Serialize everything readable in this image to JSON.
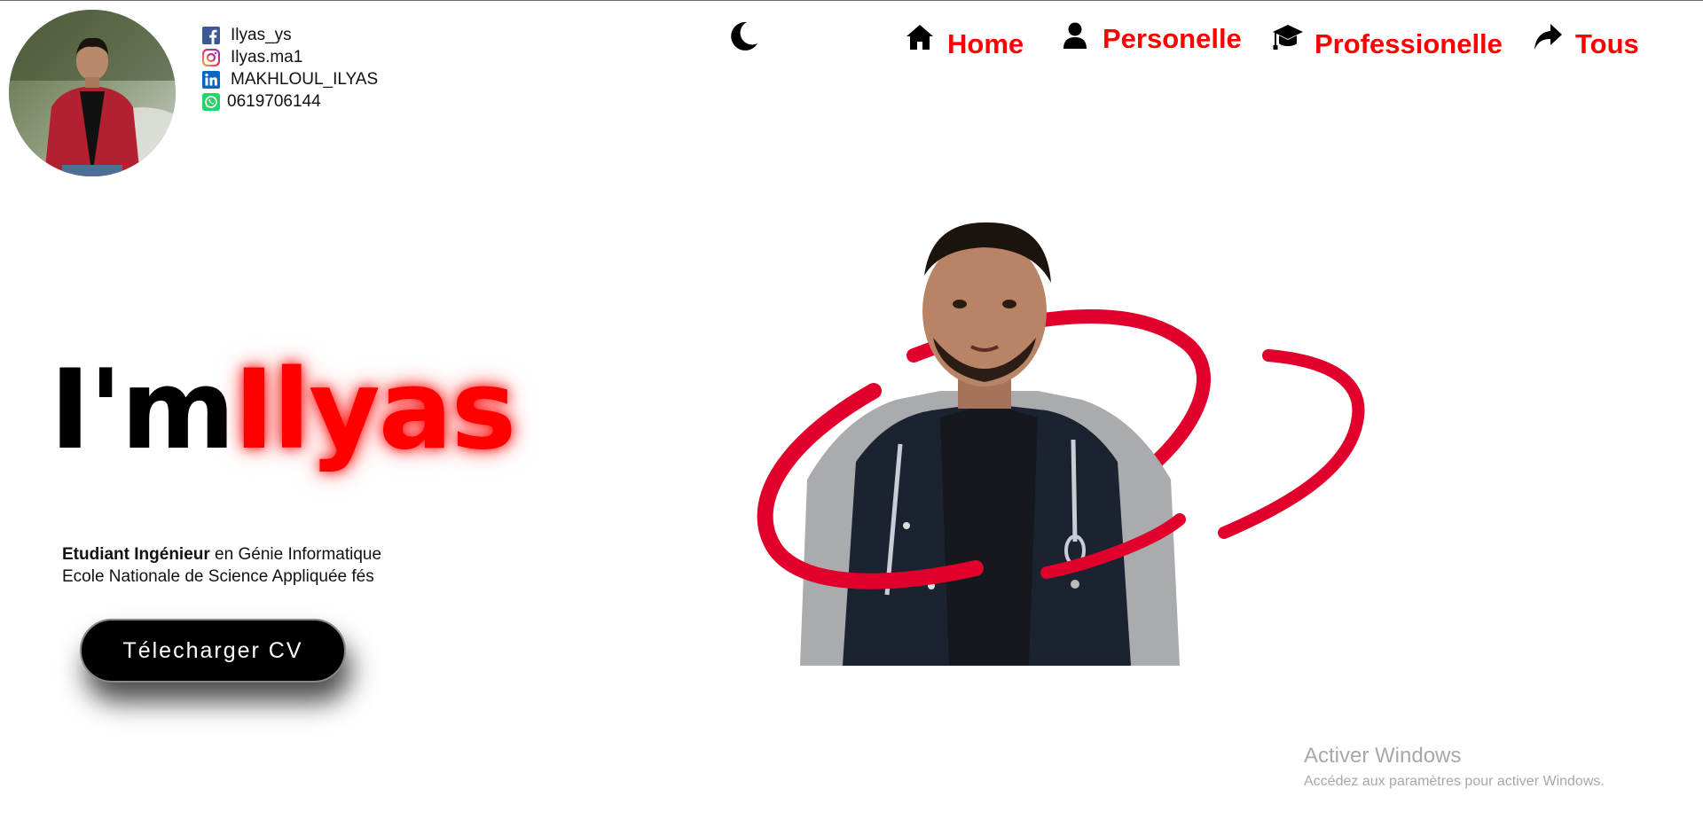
{
  "social": {
    "facebook": "Ilyas_ys",
    "instagram": "Ilyas.ma1",
    "linkedin": "MAKHLOUL_ILYAS",
    "whatsapp": "0619706144"
  },
  "nav": {
    "home": "Home",
    "personal": "Personelle",
    "professional": "Professionelle",
    "all": "Tous"
  },
  "hero": {
    "prefix": "I'm",
    "name": "Ilyas"
  },
  "description": {
    "line1_bold": "Etudiant Ingénieur",
    "line1_rest": " en Génie Informatique",
    "line2": "Ecole Nationale de Science Appliquée fés"
  },
  "cv_button": "Télecharger CV",
  "watermark": {
    "title": "Activer Windows",
    "subtitle": "Accédez aux paramètres pour activer Windows."
  },
  "icons": {
    "facebook": "facebook-icon",
    "instagram": "instagram-icon",
    "linkedin": "linkedin-icon",
    "whatsapp": "whatsapp-icon",
    "moon": "moon-icon",
    "home": "home-icon",
    "user": "user-icon",
    "graduation": "graduation-cap-icon",
    "share": "share-arrow-icon"
  },
  "colors": {
    "accent": "#ff0000",
    "swoosh": "#e0002b",
    "button_bg": "#000000"
  }
}
